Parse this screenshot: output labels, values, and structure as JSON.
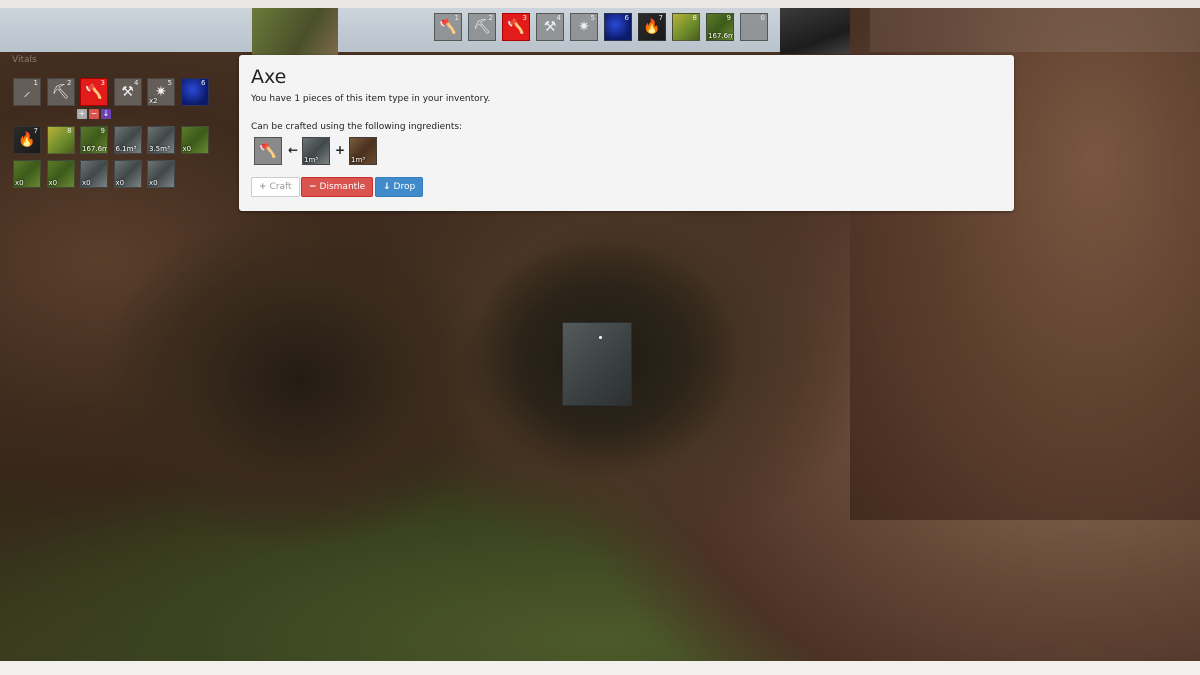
{
  "toolbar": {
    "selected_index": 3,
    "slots": [
      {
        "num": "1",
        "icon": "shovel-icon",
        "glyph": "🪓",
        "tex": "",
        "qty": ""
      },
      {
        "num": "2",
        "icon": "pickaxe-icon",
        "glyph": "⛏",
        "tex": "",
        "qty": ""
      },
      {
        "num": "3",
        "icon": "axe-icon",
        "glyph": "🪓",
        "tex": "sel",
        "qty": ""
      },
      {
        "num": "4",
        "icon": "hammer-icon",
        "glyph": "⚒",
        "tex": "",
        "qty": ""
      },
      {
        "num": "5",
        "icon": "sparkle-icon",
        "glyph": "✷",
        "tex": "",
        "qty": ""
      },
      {
        "num": "6",
        "icon": "blue-ore-icon",
        "glyph": "",
        "tex": "tex-blue",
        "qty": ""
      },
      {
        "num": "7",
        "icon": "torch-icon",
        "glyph": "🔥",
        "tex": "tex-dark",
        "qty": ""
      },
      {
        "num": "8",
        "icon": "flower-bush-icon",
        "glyph": "",
        "tex": "tex-bush",
        "qty": ""
      },
      {
        "num": "9",
        "icon": "grass-block-icon",
        "glyph": "",
        "tex": "tex-grass",
        "qty": "167.6m³"
      },
      {
        "num": "0",
        "icon": "empty-slot-icon",
        "glyph": "",
        "tex": "",
        "qty": ""
      }
    ]
  },
  "inventory": {
    "watermark": "Vitals",
    "row1": [
      {
        "num": "1",
        "icon": "shovel-icon",
        "glyph": "⸝",
        "tex": "",
        "qty": ""
      },
      {
        "num": "2",
        "icon": "pickaxe-icon",
        "glyph": "⛏",
        "tex": "",
        "qty": ""
      },
      {
        "num": "3",
        "icon": "axe-icon",
        "glyph": "🪓",
        "tex": "sel",
        "qty": ""
      },
      {
        "num": "4",
        "icon": "hammer-icon",
        "glyph": "⚒",
        "tex": "",
        "qty": ""
      },
      {
        "num": "5",
        "icon": "sparkle-icon",
        "glyph": "✷",
        "tex": "",
        "qty": "x2"
      },
      {
        "num": "6",
        "icon": "blue-ore-icon",
        "glyph": "",
        "tex": "tex-blue",
        "qty": ""
      }
    ],
    "row2": [
      {
        "num": "7",
        "icon": "torch-icon",
        "glyph": "🔥",
        "tex": "tex-dark",
        "qty": ""
      },
      {
        "num": "8",
        "icon": "flower-bush-icon",
        "glyph": "",
        "tex": "tex-bush",
        "qty": ""
      },
      {
        "num": "9",
        "icon": "grass-block-icon",
        "glyph": "",
        "tex": "tex-grass",
        "qty": "167.6m³"
      },
      {
        "num": "",
        "icon": "ore-block-icon",
        "glyph": "",
        "tex": "tex-ore",
        "qty": "6.1m³"
      },
      {
        "num": "",
        "icon": "stone-block-icon",
        "glyph": "",
        "tex": "tex-ore",
        "qty": "3.5m³"
      },
      {
        "num": "",
        "icon": "leaf-block-icon",
        "glyph": "",
        "tex": "tex-grass",
        "qty": "x0"
      }
    ],
    "row3": [
      {
        "num": "",
        "icon": "seed-bag-icon",
        "glyph": "",
        "tex": "tex-grass",
        "qty": "x0"
      },
      {
        "num": "",
        "icon": "seed-bag-icon",
        "glyph": "",
        "tex": "tex-grass",
        "qty": "x0"
      },
      {
        "num": "",
        "icon": "ore-bag-icon",
        "glyph": "",
        "tex": "tex-ore",
        "qty": "x0"
      },
      {
        "num": "",
        "icon": "ore-bag-icon",
        "glyph": "",
        "tex": "tex-ore",
        "qty": "x0"
      },
      {
        "num": "",
        "icon": "ore-bag-icon",
        "glyph": "",
        "tex": "tex-ore",
        "qty": "x0"
      }
    ],
    "mini_buttons": [
      {
        "icon": "plus-icon",
        "glyph": "+",
        "color": "#aaaaaa"
      },
      {
        "icon": "minus-icon",
        "glyph": "−",
        "color": "#d9534f"
      },
      {
        "icon": "arrow-down-icon",
        "glyph": "↓",
        "color": "#6a3fb0"
      }
    ]
  },
  "item_panel": {
    "title": "Axe",
    "count_text": "You have 1 pieces of this item type in your inventory.",
    "ingredients_heading": "Can be crafted using the following ingredients:",
    "ingredients": [
      {
        "icon": "axe-icon",
        "qty": ""
      },
      {
        "icon": "ore-block-icon",
        "qty": "1m³"
      },
      {
        "icon": "wood-block-icon",
        "qty": "1m³"
      }
    ],
    "arrow": "←",
    "plus": "+",
    "buttons": {
      "craft": "Craft",
      "dismantle": "Dismantle",
      "drop": "Drop"
    }
  }
}
